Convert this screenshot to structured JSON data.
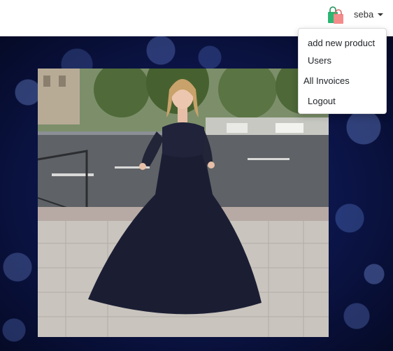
{
  "navbar": {
    "cart_icon": "shopping-bags-icon",
    "user_name": "seba"
  },
  "dropdown": {
    "items": [
      "add new product",
      "Users",
      "All Invoices",
      "Logout"
    ]
  },
  "colors": {
    "background_dark": "#0b1446",
    "dress": "#1b1e33",
    "navbar": "#ffffff"
  }
}
